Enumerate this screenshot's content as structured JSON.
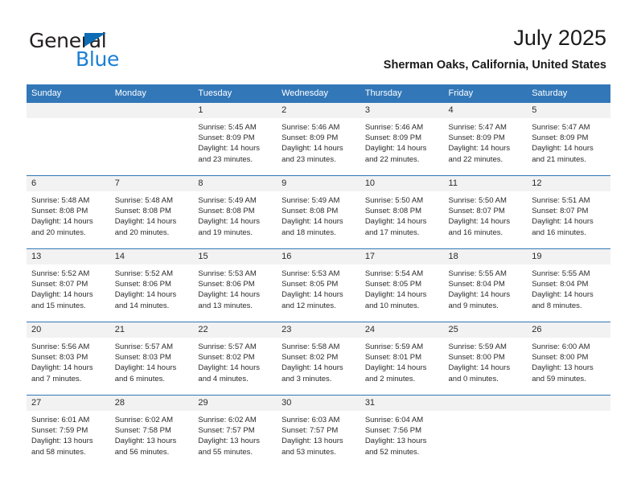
{
  "brand": {
    "name_top": "General",
    "name_bottom": "Blue",
    "accent_color": "#1b7fd4",
    "triangle_color": "#0d6cb4"
  },
  "header": {
    "title": "July 2025",
    "subtitle": "Sherman Oaks, California, United States"
  },
  "theme": {
    "header_bg": "#3277b8",
    "daynum_bg": "#f2f2f2",
    "text_color": "#2b2b2b"
  },
  "weekday_headers": [
    "Sunday",
    "Monday",
    "Tuesday",
    "Wednesday",
    "Thursday",
    "Friday",
    "Saturday"
  ],
  "weeks": [
    [
      {
        "day": "",
        "sunrise": "",
        "sunset": "",
        "daylight1": "",
        "daylight2": ""
      },
      {
        "day": "",
        "sunrise": "",
        "sunset": "",
        "daylight1": "",
        "daylight2": ""
      },
      {
        "day": "1",
        "sunrise": "Sunrise: 5:45 AM",
        "sunset": "Sunset: 8:09 PM",
        "daylight1": "Daylight: 14 hours",
        "daylight2": "and 23 minutes."
      },
      {
        "day": "2",
        "sunrise": "Sunrise: 5:46 AM",
        "sunset": "Sunset: 8:09 PM",
        "daylight1": "Daylight: 14 hours",
        "daylight2": "and 23 minutes."
      },
      {
        "day": "3",
        "sunrise": "Sunrise: 5:46 AM",
        "sunset": "Sunset: 8:09 PM",
        "daylight1": "Daylight: 14 hours",
        "daylight2": "and 22 minutes."
      },
      {
        "day": "4",
        "sunrise": "Sunrise: 5:47 AM",
        "sunset": "Sunset: 8:09 PM",
        "daylight1": "Daylight: 14 hours",
        "daylight2": "and 22 minutes."
      },
      {
        "day": "5",
        "sunrise": "Sunrise: 5:47 AM",
        "sunset": "Sunset: 8:09 PM",
        "daylight1": "Daylight: 14 hours",
        "daylight2": "and 21 minutes."
      }
    ],
    [
      {
        "day": "6",
        "sunrise": "Sunrise: 5:48 AM",
        "sunset": "Sunset: 8:08 PM",
        "daylight1": "Daylight: 14 hours",
        "daylight2": "and 20 minutes."
      },
      {
        "day": "7",
        "sunrise": "Sunrise: 5:48 AM",
        "sunset": "Sunset: 8:08 PM",
        "daylight1": "Daylight: 14 hours",
        "daylight2": "and 20 minutes."
      },
      {
        "day": "8",
        "sunrise": "Sunrise: 5:49 AM",
        "sunset": "Sunset: 8:08 PM",
        "daylight1": "Daylight: 14 hours",
        "daylight2": "and 19 minutes."
      },
      {
        "day": "9",
        "sunrise": "Sunrise: 5:49 AM",
        "sunset": "Sunset: 8:08 PM",
        "daylight1": "Daylight: 14 hours",
        "daylight2": "and 18 minutes."
      },
      {
        "day": "10",
        "sunrise": "Sunrise: 5:50 AM",
        "sunset": "Sunset: 8:08 PM",
        "daylight1": "Daylight: 14 hours",
        "daylight2": "and 17 minutes."
      },
      {
        "day": "11",
        "sunrise": "Sunrise: 5:50 AM",
        "sunset": "Sunset: 8:07 PM",
        "daylight1": "Daylight: 14 hours",
        "daylight2": "and 16 minutes."
      },
      {
        "day": "12",
        "sunrise": "Sunrise: 5:51 AM",
        "sunset": "Sunset: 8:07 PM",
        "daylight1": "Daylight: 14 hours",
        "daylight2": "and 16 minutes."
      }
    ],
    [
      {
        "day": "13",
        "sunrise": "Sunrise: 5:52 AM",
        "sunset": "Sunset: 8:07 PM",
        "daylight1": "Daylight: 14 hours",
        "daylight2": "and 15 minutes."
      },
      {
        "day": "14",
        "sunrise": "Sunrise: 5:52 AM",
        "sunset": "Sunset: 8:06 PM",
        "daylight1": "Daylight: 14 hours",
        "daylight2": "and 14 minutes."
      },
      {
        "day": "15",
        "sunrise": "Sunrise: 5:53 AM",
        "sunset": "Sunset: 8:06 PM",
        "daylight1": "Daylight: 14 hours",
        "daylight2": "and 13 minutes."
      },
      {
        "day": "16",
        "sunrise": "Sunrise: 5:53 AM",
        "sunset": "Sunset: 8:05 PM",
        "daylight1": "Daylight: 14 hours",
        "daylight2": "and 12 minutes."
      },
      {
        "day": "17",
        "sunrise": "Sunrise: 5:54 AM",
        "sunset": "Sunset: 8:05 PM",
        "daylight1": "Daylight: 14 hours",
        "daylight2": "and 10 minutes."
      },
      {
        "day": "18",
        "sunrise": "Sunrise: 5:55 AM",
        "sunset": "Sunset: 8:04 PM",
        "daylight1": "Daylight: 14 hours",
        "daylight2": "and 9 minutes."
      },
      {
        "day": "19",
        "sunrise": "Sunrise: 5:55 AM",
        "sunset": "Sunset: 8:04 PM",
        "daylight1": "Daylight: 14 hours",
        "daylight2": "and 8 minutes."
      }
    ],
    [
      {
        "day": "20",
        "sunrise": "Sunrise: 5:56 AM",
        "sunset": "Sunset: 8:03 PM",
        "daylight1": "Daylight: 14 hours",
        "daylight2": "and 7 minutes."
      },
      {
        "day": "21",
        "sunrise": "Sunrise: 5:57 AM",
        "sunset": "Sunset: 8:03 PM",
        "daylight1": "Daylight: 14 hours",
        "daylight2": "and 6 minutes."
      },
      {
        "day": "22",
        "sunrise": "Sunrise: 5:57 AM",
        "sunset": "Sunset: 8:02 PM",
        "daylight1": "Daylight: 14 hours",
        "daylight2": "and 4 minutes."
      },
      {
        "day": "23",
        "sunrise": "Sunrise: 5:58 AM",
        "sunset": "Sunset: 8:02 PM",
        "daylight1": "Daylight: 14 hours",
        "daylight2": "and 3 minutes."
      },
      {
        "day": "24",
        "sunrise": "Sunrise: 5:59 AM",
        "sunset": "Sunset: 8:01 PM",
        "daylight1": "Daylight: 14 hours",
        "daylight2": "and 2 minutes."
      },
      {
        "day": "25",
        "sunrise": "Sunrise: 5:59 AM",
        "sunset": "Sunset: 8:00 PM",
        "daylight1": "Daylight: 14 hours",
        "daylight2": "and 0 minutes."
      },
      {
        "day": "26",
        "sunrise": "Sunrise: 6:00 AM",
        "sunset": "Sunset: 8:00 PM",
        "daylight1": "Daylight: 13 hours",
        "daylight2": "and 59 minutes."
      }
    ],
    [
      {
        "day": "27",
        "sunrise": "Sunrise: 6:01 AM",
        "sunset": "Sunset: 7:59 PM",
        "daylight1": "Daylight: 13 hours",
        "daylight2": "and 58 minutes."
      },
      {
        "day": "28",
        "sunrise": "Sunrise: 6:02 AM",
        "sunset": "Sunset: 7:58 PM",
        "daylight1": "Daylight: 13 hours",
        "daylight2": "and 56 minutes."
      },
      {
        "day": "29",
        "sunrise": "Sunrise: 6:02 AM",
        "sunset": "Sunset: 7:57 PM",
        "daylight1": "Daylight: 13 hours",
        "daylight2": "and 55 minutes."
      },
      {
        "day": "30",
        "sunrise": "Sunrise: 6:03 AM",
        "sunset": "Sunset: 7:57 PM",
        "daylight1": "Daylight: 13 hours",
        "daylight2": "and 53 minutes."
      },
      {
        "day": "31",
        "sunrise": "Sunrise: 6:04 AM",
        "sunset": "Sunset: 7:56 PM",
        "daylight1": "Daylight: 13 hours",
        "daylight2": "and 52 minutes."
      },
      {
        "day": "",
        "sunrise": "",
        "sunset": "",
        "daylight1": "",
        "daylight2": ""
      },
      {
        "day": "",
        "sunrise": "",
        "sunset": "",
        "daylight1": "",
        "daylight2": ""
      }
    ]
  ]
}
